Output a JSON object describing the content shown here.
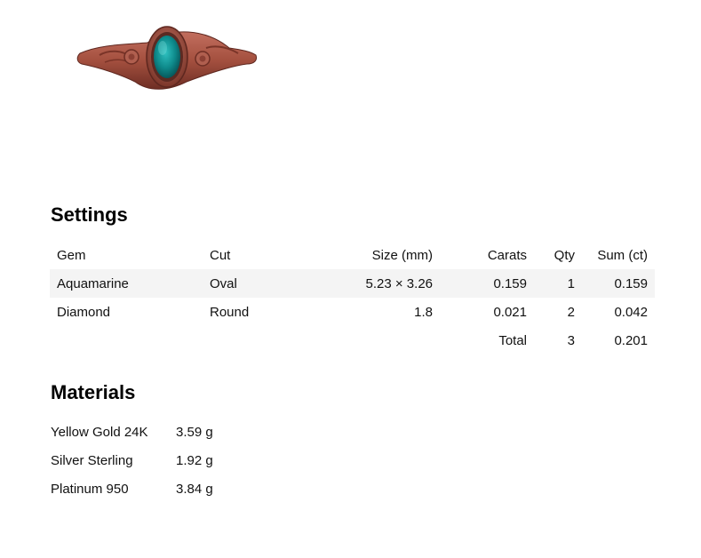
{
  "settings": {
    "heading": "Settings",
    "columns": {
      "gem": "Gem",
      "cut": "Cut",
      "size": "Size (mm)",
      "carats": "Carats",
      "qty": "Qty",
      "sum": "Sum (ct)"
    },
    "rows": [
      {
        "gem": "Aquamarine",
        "cut": "Oval",
        "size": "5.23 × 3.26",
        "carats": "0.159",
        "qty": "1",
        "sum": "0.159"
      },
      {
        "gem": "Diamond",
        "cut": "Round",
        "size": "1.8",
        "carats": "0.021",
        "qty": "2",
        "sum": "0.042"
      }
    ],
    "total": {
      "label": "Total",
      "qty": "3",
      "sum": "0.201"
    }
  },
  "materials": {
    "heading": "Materials",
    "items": [
      {
        "name": "Yellow Gold 24K",
        "weight": "3.59 g"
      },
      {
        "name": "Silver Sterling",
        "weight": "1.92 g"
      },
      {
        "name": "Platinum 950",
        "weight": "3.84 g"
      }
    ]
  },
  "colors": {
    "ring_metal": "#a9574a",
    "gemstone": "#0f8a8c",
    "row_shade": "#f4f4f4"
  }
}
